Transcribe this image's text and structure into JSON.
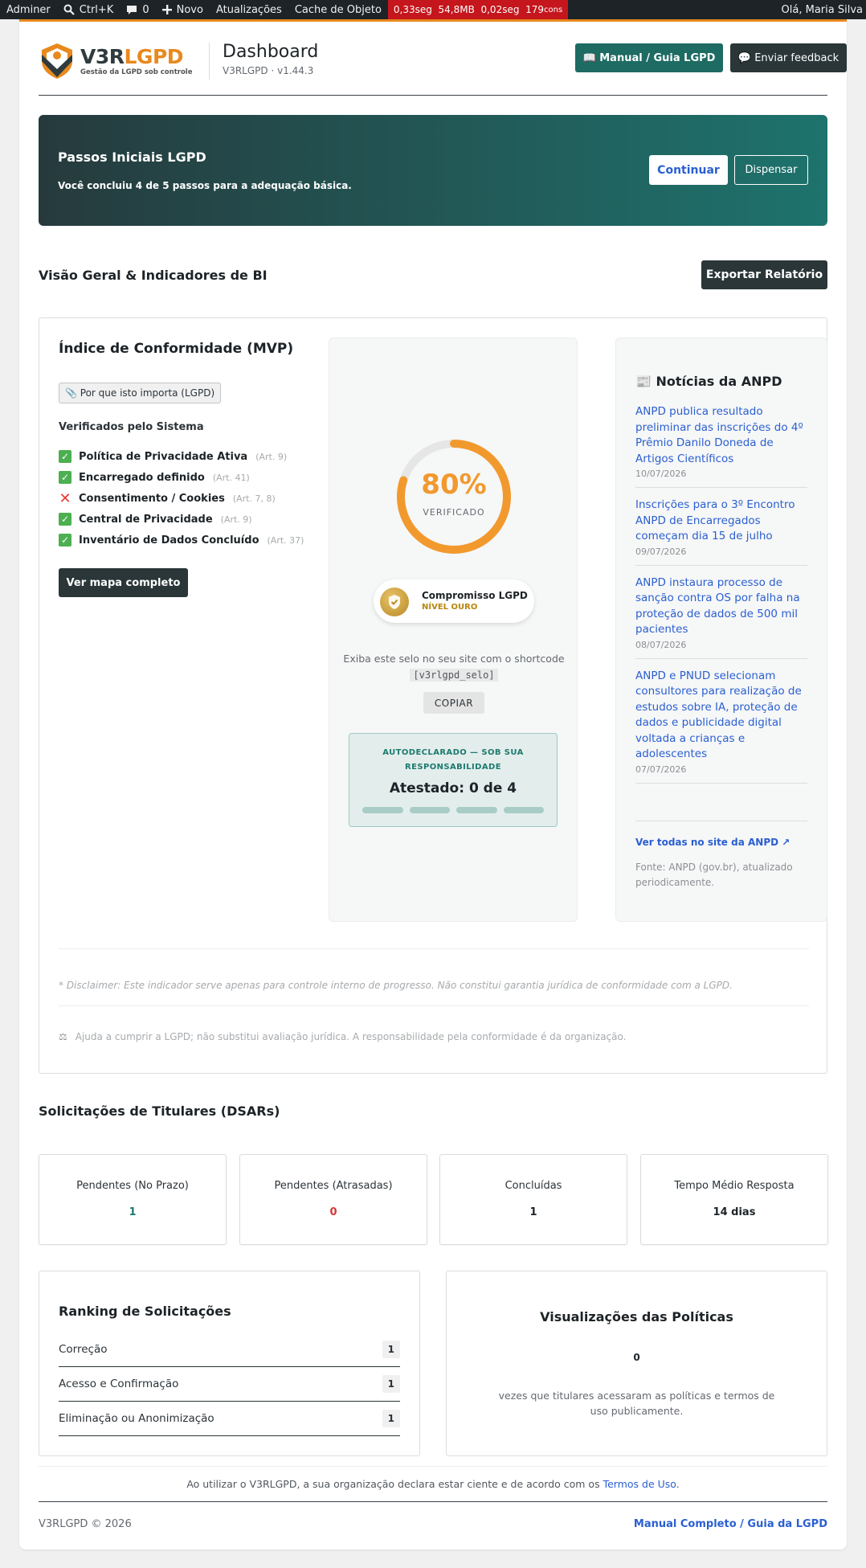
{
  "adminbar": {
    "site": "Adminer",
    "search": "Ctrl+K",
    "comments": "0",
    "new": "Novo",
    "updates": "Atualizações",
    "cache": "Cache de Objeto",
    "qm_time": "0,33seg",
    "qm_mem": "54,8MB",
    "qm_db": "0,02seg",
    "qm_queries": "179",
    "qm_queries_suffix": "cons",
    "greeting": "Olá, Maria Silva"
  },
  "header": {
    "logo_v3": "V3R",
    "logo_lgpd": "LGPD",
    "logo_tag": "Gestão da LGPD sob controle",
    "title": "Dashboard",
    "version": "V3RLGPD · v1.44.3",
    "manual_btn": "📖 Manual / Guia LGPD",
    "feedback_btn": "💬 Enviar feedback"
  },
  "passos": {
    "title": "Passos Iniciais LGPD",
    "text": "Você concluiu 4 de 5 passos para a adequação básica.",
    "continue": "Continuar",
    "dismiss": "Dispensar"
  },
  "overview": {
    "title": "Visão Geral & Indicadores de BI",
    "export": "Exportar Relatório"
  },
  "compliance": {
    "title": "Índice de Conformidade (MVP)",
    "why": "📎 Por que isto importa (LGPD)",
    "verified_title": "Verificados pelo Sistema",
    "items": [
      {
        "label": "Política de Privacidade Ativa",
        "art": "(Art. 9)",
        "ok": true
      },
      {
        "label": "Encarregado definido",
        "art": "(Art. 41)",
        "ok": true
      },
      {
        "label": "Consentimento / Cookies",
        "art": "(Art. 7, 8)",
        "ok": false
      },
      {
        "label": "Central de Privacidade",
        "art": "(Art. 9)",
        "ok": true
      },
      {
        "label": "Inventário de Dados Concluído",
        "art": "(Art. 37)",
        "ok": true
      }
    ],
    "map_btn": "Ver mapa completo",
    "percent": 80,
    "percent_label": "80%",
    "verified_word": "VERIFICADO",
    "seal_title": "Compromisso LGPD",
    "seal_level": "NÍVEL OURO",
    "shortcode_text": "Exiba este selo no seu site com o shortcode",
    "shortcode": "[v3rlgpd_selo]",
    "copy_btn": "COPIAR",
    "attest_title": "AUTODECLARADO — SOB SUA RESPONSABILIDADE",
    "attest_value": "Atestado: 0 de 4",
    "attest_done": 0,
    "attest_total": 4,
    "colors": {
      "gauge": "#f2992e",
      "gauge_track": "#e6e6e6",
      "ok": "#4caf50",
      "fail": "#e53935"
    }
  },
  "news": {
    "title": "📰 Notícias da ANPD",
    "items": [
      {
        "title": "ANPD publica resultado preliminar das inscrições do 4º Prêmio Danilo Doneda de Artigos Científicos",
        "date": "10/07/2026"
      },
      {
        "title": "Inscrições para o 3º Encontro ANPD de Encarregados começam dia 15 de julho",
        "date": "09/07/2026"
      },
      {
        "title": "ANPD instaura processo de sanção contra OS por falha na proteção de dados de 500 mil pacientes",
        "date": "08/07/2026"
      },
      {
        "title": "ANPD e PNUD selecionam consultores para realização de estudos sobre IA, proteção de dados e publicidade digital voltada a crianças e adolescentes",
        "date": "07/07/2026"
      }
    ],
    "more": "Ver todas no site da ANPD ↗",
    "source": "Fonte: ANPD (gov.br), atualizado periodicamente."
  },
  "disclaimer": "* Disclaimer: Este indicador serve apenas para controle interno de progresso. Não constitui garantia jurídica de conformidade com a LGPD.",
  "helps": "Ajuda a cumprir a LGPD; não substitui avaliação jurídica. A responsabilidade pela conformidade é da organização.",
  "dsar": {
    "title": "Solicitações de Titulares (DSARs)",
    "kpis": [
      {
        "label": "Pendentes (No Prazo)",
        "value": "1",
        "color": "#1d7a6e"
      },
      {
        "label": "Pendentes (Atrasadas)",
        "value": "0",
        "color": "#d63638"
      },
      {
        "label": "Concluídas",
        "value": "1",
        "color": "#1d2327"
      },
      {
        "label": "Tempo Médio Resposta",
        "value": "14 dias",
        "color": "#1d2327"
      }
    ]
  },
  "ranking": {
    "title": "Ranking de Solicitações",
    "rows": [
      {
        "label": "Correção",
        "count": "1"
      },
      {
        "label": "Acesso e Confirmação",
        "count": "1"
      },
      {
        "label": "Eliminação ou Anonimização",
        "count": "1"
      }
    ]
  },
  "views": {
    "title": "Visualizações das Políticas",
    "value": "0",
    "desc": "vezes que titulares acessaram as políticas e termos de uso publicamente."
  },
  "footer": {
    "terms_pre": "Ao utilizar o V3RLGPD, a sua organização declara estar ciente e de acordo com os ",
    "terms_link": "Termos de Uso",
    "terms_post": ".",
    "copyright": "V3RLGPD © 2026",
    "manual_link": "Manual Completo / Guia da LGPD"
  }
}
